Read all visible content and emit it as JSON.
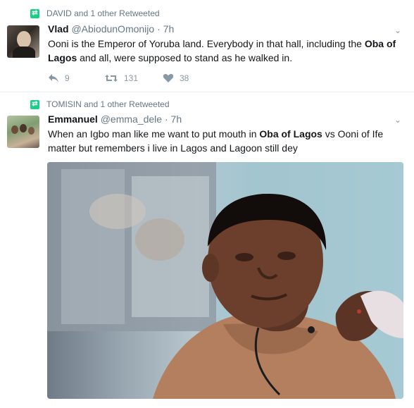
{
  "tweets": [
    {
      "retweet_context": "DAVID and 1 other Retweeted",
      "display_name": "Vlad",
      "handle": "@AbiodunOmonijo",
      "separator": "·",
      "time": "7h",
      "text_segments": [
        {
          "t": "Ooni is the Emperor of Yoruba land. Everybody in that hall, including the ",
          "b": false
        },
        {
          "t": "Oba of Lagos",
          "b": true
        },
        {
          "t": " and all, were supposed to stand as he walked in.",
          "b": false
        }
      ],
      "reply_count": "9",
      "retweet_count": "131",
      "like_count": "38"
    },
    {
      "retweet_context": "TOMISIN and 1 other Retweeted",
      "display_name": "Emmanuel",
      "handle": "@emma_dele",
      "separator": "·",
      "time": "7h",
      "text_segments": [
        {
          "t": "When an Igbo man like me want to put mouth in ",
          "b": false
        },
        {
          "t": "Oba of Lagos",
          "b": true
        },
        {
          "t": " vs Ooni of Ife matter but remembers i live in Lagos and  Lagoon still dey",
          "b": false
        }
      ]
    }
  ],
  "icons": {
    "retweet_badge": "retweet-badge-icon",
    "reply": "reply-icon",
    "retweet": "retweet-icon",
    "like": "heart-icon",
    "menu": "chevron-down-icon"
  },
  "colors": {
    "retweet_green": "#19cf86",
    "meta_gray": "#657786",
    "action_gray": "#8899a6"
  }
}
